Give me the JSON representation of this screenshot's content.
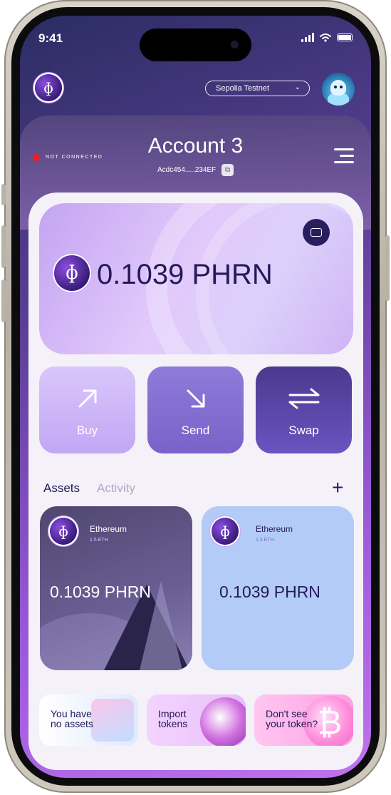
{
  "status_bar": {
    "time": "9:41"
  },
  "header": {
    "logo_glyph": "ɸ",
    "network": "Sepolia Testnet",
    "connection_status": "NOT CONNECTED",
    "account_name": "Account 3",
    "account_address": "Acdc454.....234EF"
  },
  "balance": {
    "glyph": "ɸ",
    "value": "0.1039 PHRN"
  },
  "actions": [
    {
      "label": "Buy",
      "icon": "arrow-up-right-icon"
    },
    {
      "label": "Send",
      "icon": "arrow-down-right-icon"
    },
    {
      "label": "Swap",
      "icon": "swap-arrows-icon"
    }
  ],
  "tabs": {
    "assets": "Assets",
    "activity": "Activity"
  },
  "assets": [
    {
      "name": "Ethereum",
      "sub": "1.5 ETH",
      "value": "0.1039 PHRN",
      "glyph": "ɸ"
    },
    {
      "name": "Ethereum",
      "sub": "1.5 ETH",
      "value": "0.1039 PHRN",
      "glyph": "ɸ"
    }
  ],
  "promos": [
    {
      "line1": "You have",
      "line2": "no assets"
    },
    {
      "line1": "Import",
      "line2": "tokens"
    },
    {
      "line1": "Don't see",
      "line2": "your token?"
    }
  ],
  "colors": {
    "accent": "#24195a",
    "not_connected": "#ff1a1a",
    "asset_light": "#b3cbf7"
  }
}
